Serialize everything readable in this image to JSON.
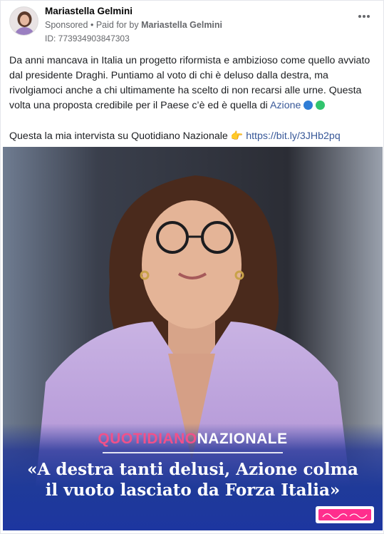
{
  "post": {
    "author": "Mariastella Gelmini",
    "sponsored_label": "Sponsored",
    "separator": "•",
    "paid_for_prefix": "Paid for by",
    "paid_for_name": "Mariastella Gelmini",
    "ad_id": "ID: 773934903847303",
    "more_icon": "more-options-icon",
    "body": {
      "paragraph1_text": "Da anni mancava in Italia un progetto riformista e ambizioso come quello avviato dal presidente Draghi. Puntiamo al voto di chi è deluso dalla destra, ma rivolgiamoci anche a chi ultimamente ha scelto di non recarsi alle urne. Questa volta una proposta credibile per il Paese c’è ed è quella di",
      "paragraph1_link": "Azione",
      "paragraph1_emoji_colors": [
        "#2f7dd6",
        "#31c46e"
      ],
      "paragraph2_text": "Questa la mia intervista su Quotidiano Nazionale",
      "paragraph2_emoji": "👉",
      "paragraph2_link": "https://bit.ly/3JHb2pq"
    },
    "image": {
      "brand_part1": "QUOTIDIANO",
      "brand_part2": "NAZIONALE",
      "headline_line1": "«A destra tanti delusi, Azione colma",
      "headline_line2": "il vuoto lasciato da Forza Italia»",
      "brand_accent": "#f0518a",
      "band_color": "#1f3a99"
    }
  }
}
